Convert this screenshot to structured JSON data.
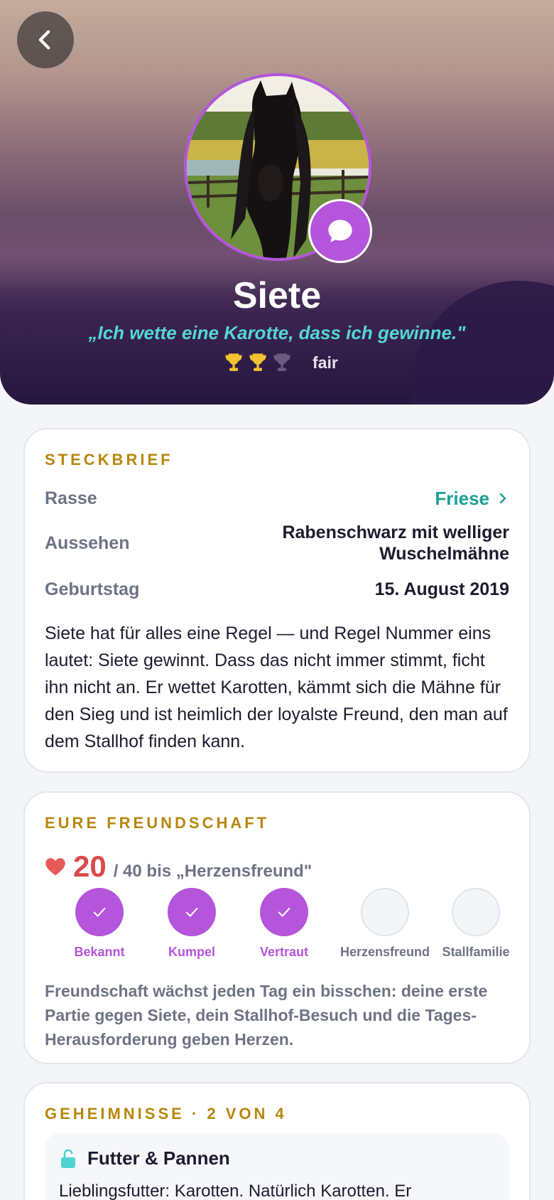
{
  "profile": {
    "name": "Siete",
    "quote": "„Ich wette eine Karotte, dass ich gewinne.\"",
    "trophies_earned": 2,
    "trophies_total": 3,
    "rating": "fair"
  },
  "steckbrief": {
    "title": "STECKBRIEF",
    "rows": [
      {
        "label": "Rasse",
        "value": "Friese"
      },
      {
        "label": "Aussehen",
        "value_line1": "Rabenschwarz mit welliger",
        "value_line2": "Wuschelmähne"
      },
      {
        "label": "Geburtstag",
        "value": "15. August 2019"
      }
    ],
    "bio": "Siete hat für alles eine Regel — und Regel Nummer eins lautet: Siete gewinnt. Dass das nicht immer stimmt, ficht ihn nicht an. Er wettet Karotten, kämmt sich die Mähne für den Sieg und ist heimlich der loyalste Freund, den man auf dem Stallhof finden kann."
  },
  "friendship": {
    "title": "EURE FREUNDSCHAFT",
    "points": "20",
    "goal_text": "/ 40 bis „Herzensfreund\"",
    "levels": [
      {
        "label": "Bekannt",
        "done": true
      },
      {
        "label": "Kumpel",
        "done": true
      },
      {
        "label": "Vertraut",
        "done": true
      },
      {
        "label": "Herzensfreund",
        "done": false
      },
      {
        "label": "Stallfamilie",
        "done": false
      }
    ],
    "note": "Freundschaft wächst jeden Tag ein bisschen: deine erste Partie gegen Siete, dein Stallhof-Besuch und die Tages-Herausforderung geben Herzen."
  },
  "secrets": {
    "title": "GEHEIMNISSE · 2 VON 4",
    "items": [
      {
        "title": "Futter & Pannen",
        "text": "Lieblingsfutter: Karotten. Natürlich Karotten. Er"
      }
    ]
  },
  "colors": {
    "accent_purple": "#b455db",
    "gold": "#b8860b",
    "teal": "#1c9f98",
    "heart_red": "#d94a4a",
    "quote_cyan": "#55d6d6"
  }
}
